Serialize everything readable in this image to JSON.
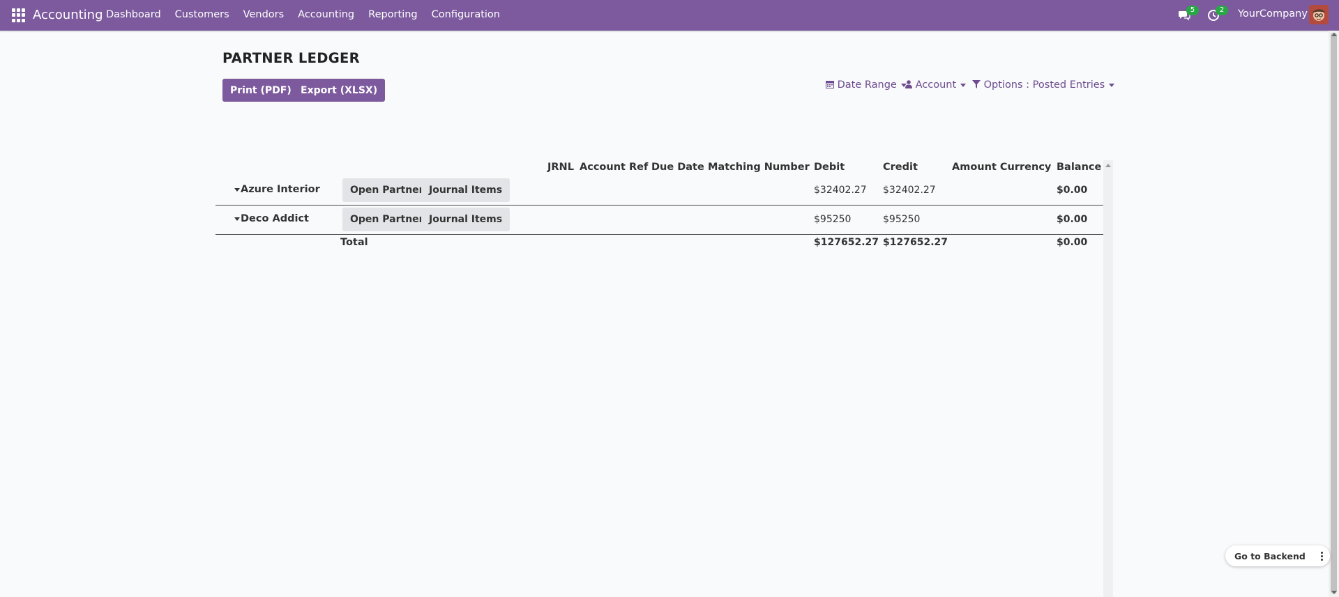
{
  "navbar": {
    "brand": "Accounting",
    "menu": [
      "Dashboard",
      "Customers",
      "Vendors",
      "Accounting",
      "Reporting",
      "Configuration"
    ],
    "messages_count": "5",
    "activities_count": "2",
    "company": "YourCompany"
  },
  "page": {
    "title": "PARTNER LEDGER",
    "print_label": "Print (PDF)",
    "export_label": "Export (XLSX)",
    "filters": {
      "date_range": "Date Range",
      "account": "Account",
      "options": "Options : Posted Entries"
    }
  },
  "table": {
    "columns": [
      "JRNL",
      "Account",
      "Ref",
      "Due Date",
      "Matching Number",
      "Debit",
      "Credit",
      "Amount Currency",
      "Balance"
    ],
    "open_partner_label": "Open Partner",
    "journal_items_label": "Journal Items",
    "rows": [
      {
        "partner": "Azure Interior",
        "debit": "$32402.27",
        "credit": "$32402.27",
        "balance": "$0.00"
      },
      {
        "partner": "Deco Addict",
        "debit": "$95250",
        "credit": "$95250",
        "balance": "$0.00"
      }
    ],
    "total": {
      "label": "Total",
      "debit": "$127652.27",
      "credit": "$127652.27",
      "balance": "$0.00"
    }
  },
  "footer": {
    "go_to_backend": "Go to Backend"
  }
}
